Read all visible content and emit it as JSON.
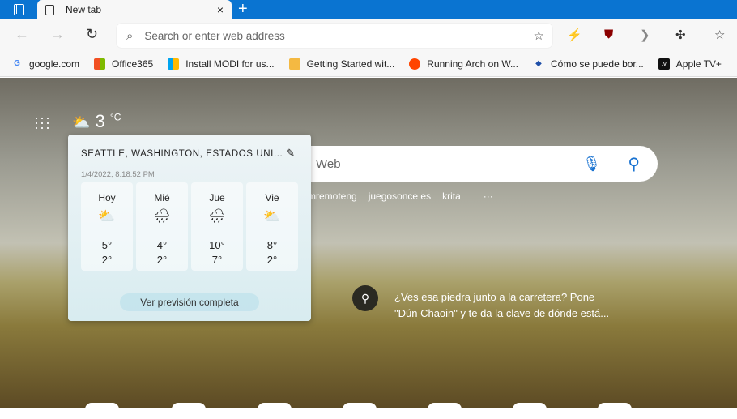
{
  "tab": {
    "title": "New tab",
    "close": "×",
    "new": "+"
  },
  "address": {
    "placeholder": "Search or enter web address"
  },
  "bookmarks": [
    {
      "label": "google.com",
      "icon": "google-icon",
      "glyph": "G",
      "color": "#4285f4"
    },
    {
      "label": "Office365",
      "icon": "microsoft-icon",
      "glyph": "▦",
      "color": "#f25022"
    },
    {
      "label": "Install MODI for us...",
      "icon": "microsoft-icon",
      "glyph": "▦",
      "color": "#7fba00"
    },
    {
      "label": "Getting Started wit...",
      "icon": "hex-icon",
      "glyph": "⬡",
      "color": "#f4b942"
    },
    {
      "label": "Running Arch on W...",
      "icon": "reddit-icon",
      "glyph": "●",
      "color": "#ff4500"
    },
    {
      "label": "Cómo se puede bor...",
      "icon": "diamond-icon",
      "glyph": "◆",
      "color": "#1f4fa8"
    },
    {
      "label": "Apple TV+",
      "icon": "appletv-icon",
      "glyph": "tv",
      "color": "#111111"
    }
  ],
  "weather": {
    "temp": "3",
    "unit": "°C",
    "location": "SEATTLE, WASHINGTON, ESTADOS UNI...",
    "updated": "1/4/2022, 8:18:52 PM",
    "days": [
      {
        "name": "Hoy",
        "icon": "⛅",
        "high": "5°",
        "low": "2°"
      },
      {
        "name": "Mié",
        "icon": "🌧",
        "high": "4°",
        "low": "2°"
      },
      {
        "name": "Jue",
        "icon": "🌧",
        "high": "10°",
        "low": "7°"
      },
      {
        "name": "Vie",
        "icon": "⛅",
        "high": "8°",
        "low": "2°"
      }
    ],
    "full": "Ver previsión completa"
  },
  "search": {
    "placeholder": "Web"
  },
  "quicklinks": [
    "mremoteng",
    "juegosonce es",
    "krita",
    "···"
  ],
  "fact": "¿Ves esa piedra junto a la carretera? Pone \"Dún Chaoin\" y te da la clave de dónde está..."
}
